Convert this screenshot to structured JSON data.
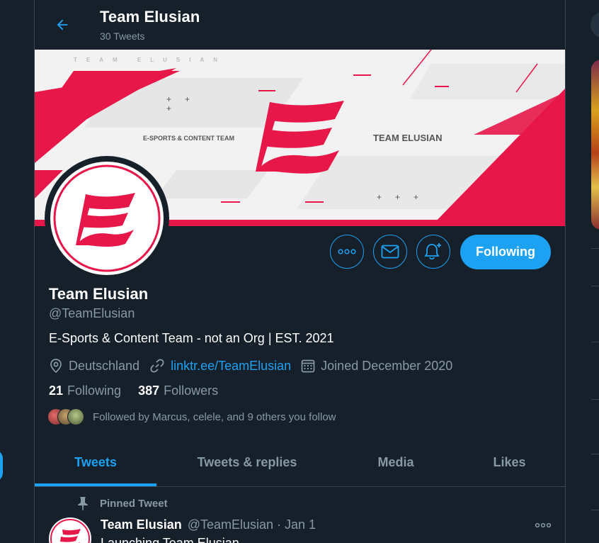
{
  "header": {
    "title": "Team Elusian",
    "tweet_count": "30 Tweets"
  },
  "banner": {
    "org_text": "TEAM ELUSIAN",
    "left_text": "E-SPORTS & CONTENT TEAM",
    "right_text": "TEAM ELUSIAN"
  },
  "actions": {
    "follow_label": "Following"
  },
  "profile": {
    "name": "Team Elusian",
    "handle": "@TeamElusian",
    "bio": "E-Sports & Content Team - not an Org | EST. 2021",
    "location": "Deutschland",
    "link": "linktr.ee/TeamElusian",
    "joined": "Joined December 2020"
  },
  "stats": {
    "following_count": "21",
    "following_label": "Following",
    "followers_count": "387",
    "followers_label": "Followers"
  },
  "followed_by": "Followed by Marcus, celele, and 9 others you follow",
  "tabs": [
    {
      "label": "Tweets",
      "active": true
    },
    {
      "label": "Tweets & replies",
      "active": false
    },
    {
      "label": "Media",
      "active": false
    },
    {
      "label": "Likes",
      "active": false
    }
  ],
  "pinned": {
    "label": "Pinned Tweet",
    "name": "Team Elusian",
    "meta": "@TeamElusian · Jan 1",
    "text": "Launching Team Elusian"
  },
  "colors": {
    "accent": "#1da1f2",
    "brand_red": "#e8174a",
    "background": "#15202b",
    "secondary_text": "#8899a6"
  }
}
